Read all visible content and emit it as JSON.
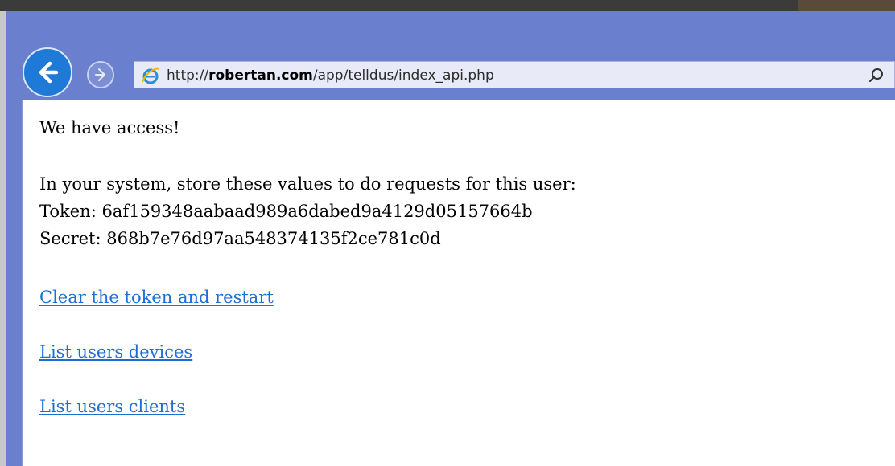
{
  "browser": {
    "address": {
      "prefix": "http://",
      "domain": "robertan.com",
      "path": "/app/telldus/index_api.php"
    },
    "icons": {
      "back": "back-arrow-icon",
      "forward": "forward-arrow-icon",
      "site": "ie-logo-icon",
      "search": "search-icon"
    },
    "colors": {
      "frame": "#6b7fcf",
      "back_button": "#1e7ad6",
      "link": "#1a6fd4"
    }
  },
  "page": {
    "heading": "We have access!",
    "instructions": "In your system, store these values to do requests for this user:",
    "token_line": "Token: 6af159348aabaad989a6dabed9a4129d05157664b",
    "secret_line": "Secret: 868b7e76d97aa548374135f2ce781c0d",
    "links": [
      {
        "label": "Clear the token and restart"
      },
      {
        "label": "List users devices"
      },
      {
        "label": "List users clients"
      }
    ]
  }
}
